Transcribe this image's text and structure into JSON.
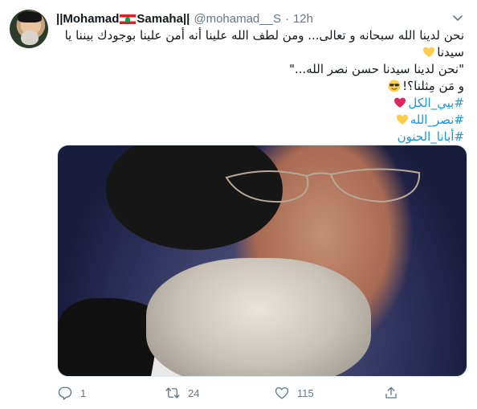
{
  "tweet": {
    "author": {
      "name_part1": "||Mohamad",
      "name_part2": "Samaha||",
      "flag_icon": "lebanon-flag-icon",
      "handle": "@mohamad__S",
      "separator": "·",
      "time": "12h"
    },
    "text_lines": [
      "نحن لدينا الله سبحانه و تعالى... ومن لطف الله علينا أنه أمن علينا بوجودك بيننا يا",
      "سيدنا",
      "\"نحن لدينا سيدنا حسن نصر الله...\"",
      "و مَن مِثلنا؟!"
    ],
    "hashtags": [
      "#بيي_الكل",
      "#نصر_الله",
      "#أبانا_الحنون"
    ],
    "media": {
      "description_icon": "photo-portrait"
    },
    "actions": {
      "reply_count": "1",
      "retweet_count": "24",
      "like_count": "115"
    },
    "colors": {
      "hashtag": "#1b95e0",
      "muted": "#657786",
      "heart_emoji": "#e0245e",
      "yellow_heart": "#ffcc4d"
    }
  }
}
